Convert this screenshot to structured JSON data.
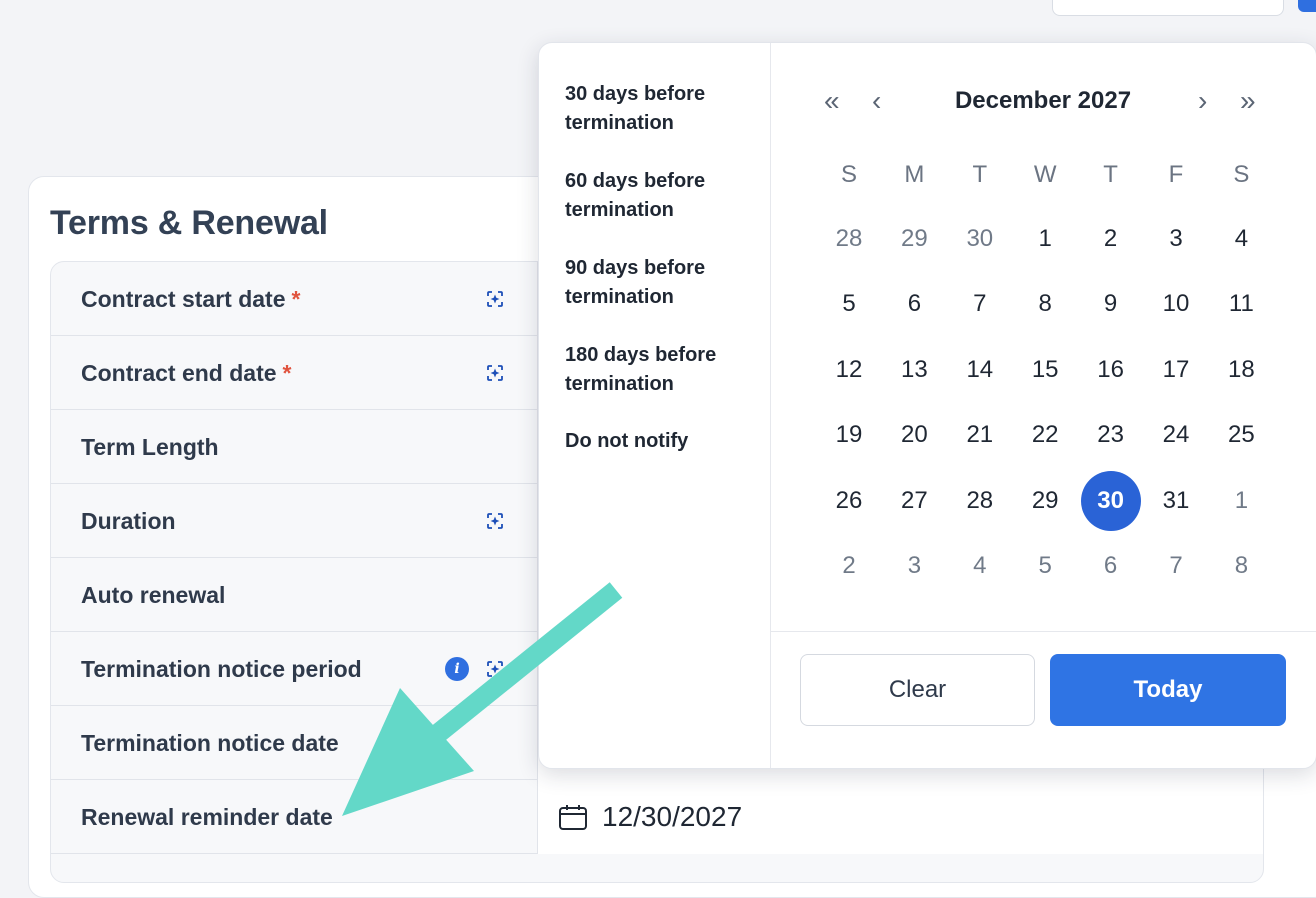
{
  "card": {
    "title": "Terms & Renewal"
  },
  "fields": [
    {
      "label": "Contract start date",
      "required": "*"
    },
    {
      "label": "Contract end date",
      "required": "*"
    },
    {
      "label": "Term Length"
    },
    {
      "label": "Duration"
    },
    {
      "label": "Auto renewal"
    },
    {
      "label": "Termination notice period",
      "info": "i"
    },
    {
      "label": "Termination notice date"
    },
    {
      "label": "Renewal reminder date",
      "value": "12/30/2027"
    }
  ],
  "presets": [
    "30 days before termination",
    "60 days before termination",
    "90 days before termination",
    "180 days before termination",
    "Do not notify"
  ],
  "calendar": {
    "month_label": "December 2027",
    "nav": {
      "prev_year": "«",
      "prev_month": "‹",
      "next_month": "›",
      "next_year": "»"
    },
    "weekdays": [
      "S",
      "M",
      "T",
      "W",
      "T",
      "F",
      "S"
    ],
    "weeks": [
      [
        "28",
        "29",
        "30",
        "1",
        "2",
        "3",
        "4"
      ],
      [
        "5",
        "6",
        "7",
        "8",
        "9",
        "10",
        "11"
      ],
      [
        "12",
        "13",
        "14",
        "15",
        "16",
        "17",
        "18"
      ],
      [
        "19",
        "20",
        "21",
        "22",
        "23",
        "24",
        "25"
      ],
      [
        "26",
        "27",
        "28",
        "29",
        "30",
        "31",
        "1"
      ],
      [
        "2",
        "3",
        "4",
        "5",
        "6",
        "7",
        "8"
      ]
    ],
    "outside_month": [
      [
        0,
        0
      ],
      [
        0,
        1
      ],
      [
        0,
        2
      ],
      [
        4,
        6
      ],
      [
        5,
        0
      ],
      [
        5,
        1
      ],
      [
        5,
        2
      ],
      [
        5,
        3
      ],
      [
        5,
        4
      ],
      [
        5,
        5
      ],
      [
        5,
        6
      ]
    ],
    "selected": [
      4,
      4
    ]
  },
  "buttons": {
    "clear": "Clear",
    "today": "Today"
  },
  "colors": {
    "accent": "#2f74e4",
    "selected": "#2a63d6",
    "annotation_arrow": "#63d8c8",
    "required": "#e0533e"
  },
  "icons": {
    "ai_field": "ai-sparkle-icon",
    "info": "info-icon",
    "calendar": "calendar-icon"
  }
}
